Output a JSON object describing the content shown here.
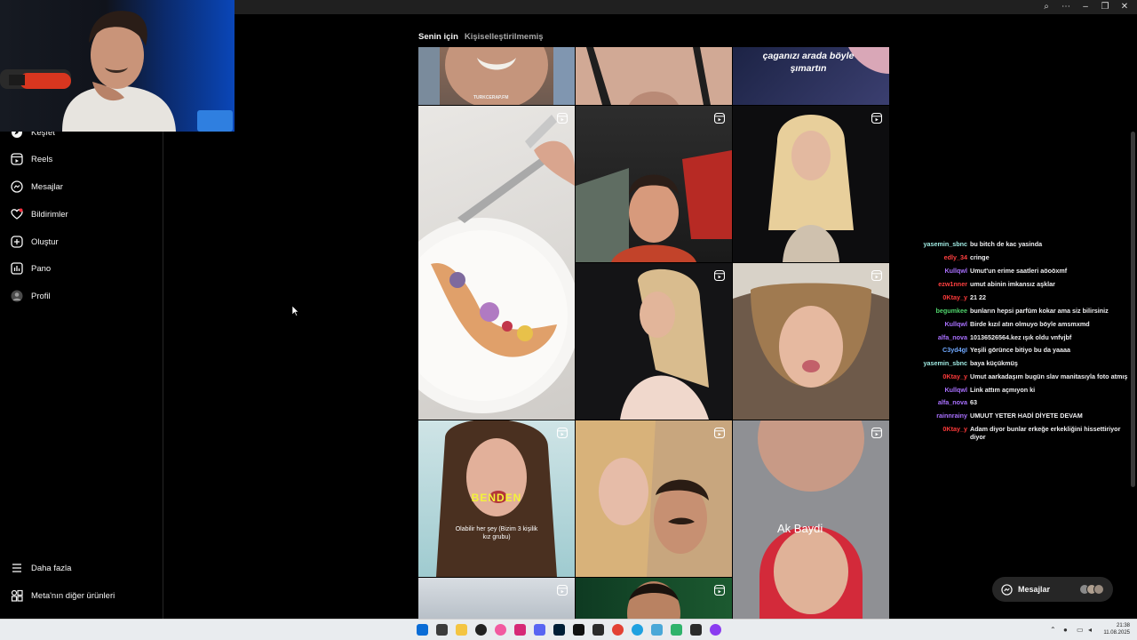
{
  "window": {
    "controls": [
      "zoom",
      "more",
      "minimize",
      "restore",
      "close"
    ]
  },
  "sidebar": {
    "items": [
      {
        "label": "Keşfet",
        "icon": "explore-icon"
      },
      {
        "label": "Reels",
        "icon": "reels-icon"
      },
      {
        "label": "Mesajlar",
        "icon": "messenger-icon"
      },
      {
        "label": "Bildirimler",
        "icon": "heart-icon"
      },
      {
        "label": "Oluştur",
        "icon": "plus-square-icon"
      },
      {
        "label": "Pano",
        "icon": "dashboard-icon"
      },
      {
        "label": "Profil",
        "icon": "avatar-icon"
      }
    ],
    "bottom": [
      {
        "label": "Daha fazla",
        "icon": "menu-icon"
      },
      {
        "label": "Meta'nın diğer ürünleri",
        "icon": "apps-icon"
      }
    ]
  },
  "tabs": {
    "for_you": "Senin için",
    "unpersonalized": "Kişiselleştirilmemiş"
  },
  "grid": {
    "tiles": [
      {
        "name": "tile-1-1",
        "overlay": "TURKCERAP.FM"
      },
      {
        "name": "tile-1-2",
        "overlay": ""
      },
      {
        "name": "tile-1-3",
        "overlay": "çaganızı arada böyle şımartın"
      },
      {
        "name": "tile-2-1",
        "overlay": ""
      },
      {
        "name": "tile-2-2",
        "overlay": ""
      },
      {
        "name": "tile-2-3",
        "overlay": ""
      },
      {
        "name": "tile-3-2",
        "overlay": ""
      },
      {
        "name": "tile-3-3",
        "overlay": ""
      },
      {
        "name": "tile-4-1",
        "overlay": "BENDEN",
        "sub": "Olabilir her şey (Bizim 3 kişilik kız grubu)"
      },
      {
        "name": "tile-4-2",
        "overlay": ""
      },
      {
        "name": "tile-4-3",
        "overlay": "Ak Baydi"
      },
      {
        "name": "tile-5-1",
        "overlay": ""
      },
      {
        "name": "tile-5-2",
        "overlay": ""
      }
    ]
  },
  "chat": {
    "messages": [
      {
        "user": "yasemin_sbnc",
        "color": "#9ee8e0",
        "text": "bu bitch de kac yasinda"
      },
      {
        "user": "edly_34",
        "color": "#ff4040",
        "text": "cringe"
      },
      {
        "user": "Kullqwl",
        "color": "#a970ff",
        "text": "Umut'un erime saatleri aöoöxmf"
      },
      {
        "user": "ezw1nner",
        "color": "#ff4040",
        "text": "umut abinin imkansız aşklar"
      },
      {
        "user": "0Ktay_y",
        "color": "#ff3a3a",
        "text": "21 22"
      },
      {
        "user": "begumkee",
        "color": "#4fd36b",
        "text": "bunların hepsi parfüm kokar ama siz bilirsiniz"
      },
      {
        "user": "Kullqwl",
        "color": "#a970ff",
        "text": "Birde kızıl atın olmuyo böyle amsmxmd"
      },
      {
        "user": "alfa_nova",
        "color": "#a970ff",
        "text": "10136526564.kez ışık oldu vnfvjbf"
      },
      {
        "user": "C3yd4gI",
        "color": "#6fa8ff",
        "text": "Yeşili görünce bitiyo bu da yaaaa"
      },
      {
        "user": "yasemin_sbnc",
        "color": "#9ee8e0",
        "text": "baya küçükmüş"
      },
      {
        "user": "0Ktay_y",
        "color": "#ff3a3a",
        "text": "Umut aarkadaşım bugün slav manitasıyla foto atmış"
      },
      {
        "user": "Kullqwl",
        "color": "#a970ff",
        "text": "Link attım açmıyon ki"
      },
      {
        "user": "alfa_nova",
        "color": "#a970ff",
        "text": "63"
      },
      {
        "user": "rainnrainy",
        "color": "#a970ff",
        "text": "UMUUT YETER HADİ DİYETE DEVAM"
      },
      {
        "user": "0Ktay_y",
        "color": "#ff3a3a",
        "text": "Adam diyor bunlar erkeğe erkekliğini hissettiriyor diyor"
      }
    ]
  },
  "messages_pill": {
    "label": "Mesajlar"
  },
  "taskbar": {
    "time": "21:38",
    "date": "11.08.2025"
  },
  "colors": {
    "background": "#000000",
    "taskbar": "#e9ecef",
    "muted_text": "#a8a8a8"
  }
}
